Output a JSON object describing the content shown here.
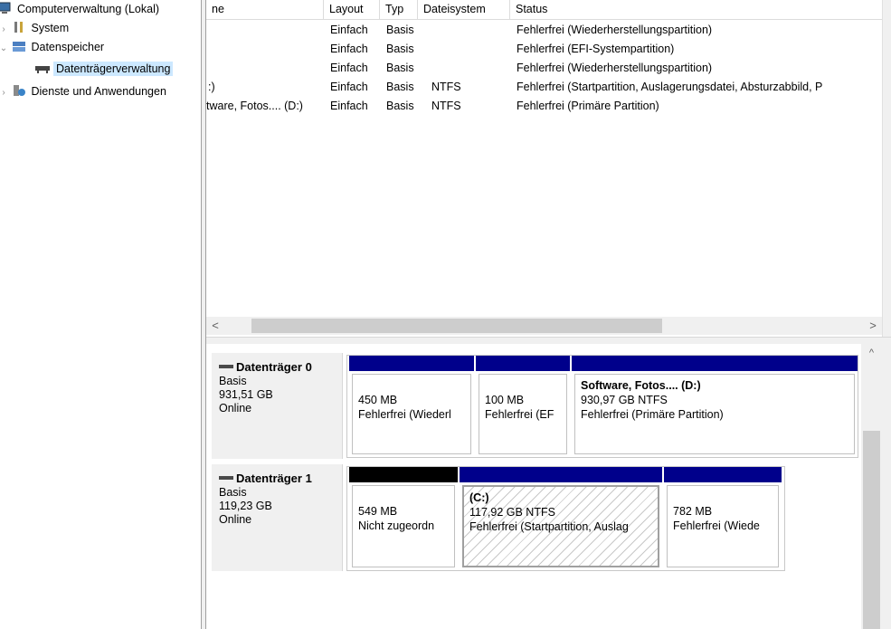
{
  "tree": {
    "items": [
      {
        "label": "Computerverwaltung (Lokal)",
        "icon": "computer-management-icon",
        "chevron": ""
      },
      {
        "label": "System",
        "icon": "system-tools-icon",
        "chevron": "›"
      },
      {
        "label": "Datenspeicher",
        "icon": "storage-icon",
        "chevron": "⌄"
      },
      {
        "label": "Datenträgerverwaltung",
        "icon": "disk-management-icon",
        "chevron": ""
      },
      {
        "label": "Dienste und Anwendungen",
        "icon": "services-icon",
        "chevron": "›"
      }
    ]
  },
  "volumes": {
    "columns": [
      "ne",
      "Layout",
      "Typ",
      "Dateisystem",
      "Status"
    ],
    "rows": [
      {
        "name": "",
        "layout": "Einfach",
        "typ": "Basis",
        "fs": "",
        "status": "Fehlerfrei (Wiederherstellungspartition)"
      },
      {
        "name": "",
        "layout": "Einfach",
        "typ": "Basis",
        "fs": "",
        "status": "Fehlerfrei (EFI-Systempartition)"
      },
      {
        "name": "",
        "layout": "Einfach",
        "typ": "Basis",
        "fs": "",
        "status": "Fehlerfrei (Wiederherstellungspartition)"
      },
      {
        "name": ":)",
        "layout": "Einfach",
        "typ": "Basis",
        "fs": "NTFS",
        "status": "Fehlerfrei (Startpartition, Auslagerungsdatei, Absturzabbild, P"
      },
      {
        "name": "tware, Fotos.... (D:)",
        "layout": "Einfach",
        "typ": "Basis",
        "fs": "NTFS",
        "status": "Fehlerfrei (Primäre Partition)"
      }
    ]
  },
  "scroll": {
    "left": "<",
    "right": ">",
    "up": "^"
  },
  "disks": [
    {
      "name": "Datenträger 0",
      "type": "Basis",
      "size": "931,51 GB",
      "state": "Online",
      "partitions": [
        {
          "title": "",
          "size": "450 MB",
          "status": "Fehlerfrei (Wiederl"
        },
        {
          "title": "",
          "size": "100 MB",
          "status": "Fehlerfrei (EF"
        },
        {
          "title": "Software, Fotos....  (D:)",
          "size": "930,97 GB NTFS",
          "status": "Fehlerfrei (Primäre Partition)"
        }
      ]
    },
    {
      "name": "Datenträger 1",
      "type": "Basis",
      "size": "119,23 GB",
      "state": "Online",
      "partitions": [
        {
          "title": "",
          "size": "549 MB",
          "status": "Nicht zugeordn"
        },
        {
          "title": "(C:)",
          "size": "117,92 GB NTFS",
          "status": "Fehlerfrei (Startpartition, Auslag"
        },
        {
          "title": "",
          "size": "782 MB",
          "status": "Fehlerfrei (Wiede"
        }
      ]
    }
  ]
}
